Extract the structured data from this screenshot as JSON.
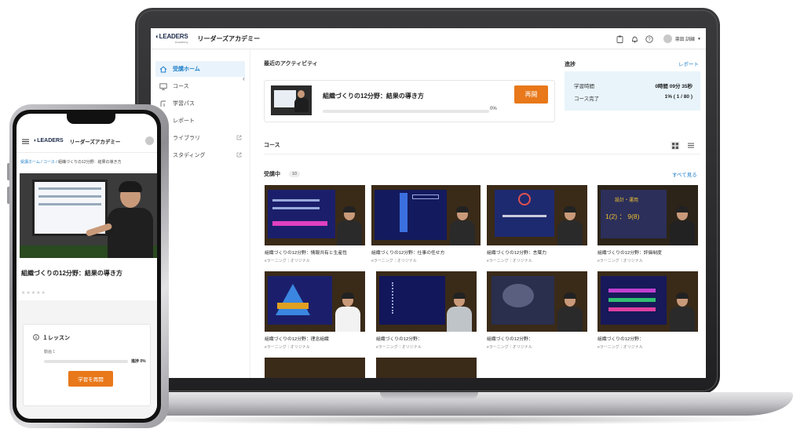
{
  "laptop": {
    "header": {
      "logo_text": "LEADERS",
      "logo_sub": "Academy",
      "app_title": "リーダーズアカデミー",
      "user_name": "凛田 訓練"
    },
    "sidebar": {
      "items": [
        {
          "label": "受講ホーム",
          "icon": "home-icon"
        },
        {
          "label": "コース",
          "icon": "monitor-icon"
        },
        {
          "label": "学習パス",
          "icon": "path-icon"
        },
        {
          "label": "レポート",
          "icon": "report-icon"
        },
        {
          "label": "ライブラリ",
          "icon": "library-icon"
        },
        {
          "label": "スタディング",
          "icon": "study-icon"
        }
      ]
    },
    "activity": {
      "section_title": "最近のアクティビティ",
      "course_name": "組織づくりの12分野：結果の導き方",
      "progress_percent": "0%",
      "progress_value": 0,
      "resume_label": "再開"
    },
    "progress": {
      "section_title": "進捗",
      "report_link": "レポート",
      "study_time_label": "学習時間",
      "study_time_value": "0時間 09分 35秒",
      "course_complete_label": "コース完了",
      "course_complete_value": "1% ( 1 / 80 )"
    },
    "courses": {
      "section_title": "コース",
      "in_progress_label": "受講中",
      "in_progress_count": "10",
      "see_all": "すべて見る",
      "cards": [
        {
          "title": "組織づくりの12分野：情報共有と生産性",
          "meta": "eラーニング｜オリジナル"
        },
        {
          "title": "組織づくりの12分野：仕事の任せ方",
          "meta": "eラーニング｜オリジナル"
        },
        {
          "title": "組織づくりの12分野：言葉力",
          "meta": "eラーニング｜オリジナル"
        },
        {
          "title": "組織づくりの12分野：評価制度",
          "meta": "eラーニング｜オリジナル"
        },
        {
          "title": "組織づくりの12分野：理念組織",
          "meta": "eラーニング｜オリジナル"
        },
        {
          "title": "組織づくりの12分野：",
          "meta": "eラーニング｜オリジナル"
        },
        {
          "title": "組織づくりの12分野：",
          "meta": "eラーニング｜オリジナル"
        },
        {
          "title": "組織づくりの12分野：",
          "meta": "eラーニング｜オリジナル"
        }
      ],
      "slide_texts": {
        "eval_title": "設計・運用",
        "eval_ratio": "1(2) ： 9(8)"
      }
    }
  },
  "phone": {
    "app_title": "リーダーズアカデミー",
    "logo_text": "LEADERS",
    "breadcrumb": [
      "受講ホーム",
      "コース",
      "組織づくりの12分野：結果の導き方"
    ],
    "course_title": "組織づくりの12分野：結果の導き方",
    "stars": "★★★★★",
    "lesson_count": "１レッスン",
    "movie_label": "動画  1",
    "progress_label": "進捗 0%",
    "resume_button": "学習を再開"
  },
  "colors": {
    "accent_orange": "#e8781a",
    "link_blue": "#1d7fc8",
    "progress_bg": "#e8f4fa"
  }
}
